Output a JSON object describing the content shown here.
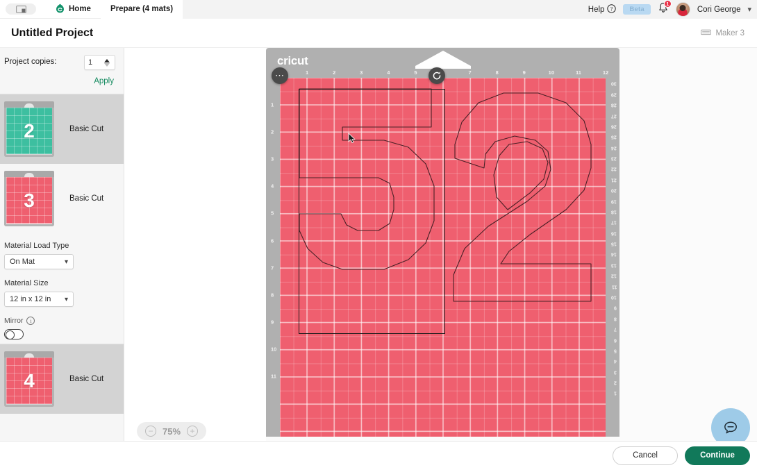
{
  "topnav": {
    "panel_toggle_icon": "panel-layout-icon",
    "home_label": "Home",
    "home_icon": "cricut-home-icon",
    "prepare_label": "Prepare (4 mats)",
    "help_label": "Help",
    "help_icon": "question-circle-icon",
    "beta_label": "Beta",
    "bell_icon": "notification-bell-icon",
    "bell_count": "1",
    "avatar_icon": "user-avatar",
    "user_name": "Cori George",
    "caret_icon": "chevron-down-icon"
  },
  "title_row": {
    "project_title": "Untitled Project",
    "machine_icon": "cutting-machine-icon",
    "machine_name": "Maker 3"
  },
  "sidebar": {
    "copies_label": "Project copies:",
    "copies_value": "1",
    "stepper_up_icon": "caret-up-icon",
    "stepper_down_icon": "caret-down-icon",
    "apply_label": "Apply",
    "mats": [
      {
        "number": "2",
        "label": "Basic Cut",
        "color": "#3dbfa0",
        "selected": false
      },
      {
        "number": "3",
        "label": "Basic Cut",
        "color": "#ef5f6f",
        "selected": true
      },
      {
        "number": "4",
        "label": "Basic Cut",
        "color": "#ef5f6f",
        "selected": false
      }
    ],
    "material_load_type_label": "Material Load Type",
    "material_load_type_value": "On Mat",
    "material_size_label": "Material Size",
    "material_size_value": "12 in x 12 in",
    "mirror_label": "Mirror",
    "mirror_info_icon": "info-circle-icon",
    "mirror_on": false,
    "chevron_icon": "chevron-down-icon"
  },
  "stage": {
    "mat_brand": "cricut",
    "mat_color": "#ef5f6f",
    "more_options_icon": "more-dots-icon",
    "rotate_icon": "rotate-clockwise-icon",
    "cursor_icon": "mouse-pointer-icon",
    "ruler_top": [
      "1",
      "2",
      "3",
      "4",
      "5",
      "6",
      "7",
      "8",
      "9",
      "10",
      "11",
      "12"
    ],
    "ruler_left": [
      "1",
      "2",
      "3",
      "4",
      "5",
      "6",
      "7",
      "8",
      "9",
      "10",
      "11"
    ],
    "ruler_right": [
      "30",
      "29",
      "28",
      "27",
      "26",
      "25",
      "24",
      "23",
      "22",
      "21",
      "20",
      "19",
      "18",
      "17",
      "16",
      "15",
      "14",
      "13",
      "12",
      "11",
      "10",
      "9",
      "8",
      "7",
      "6",
      "5",
      "4",
      "3",
      "2",
      "1"
    ],
    "design_text": "52",
    "zoom": {
      "minus_icon": "minus-circle-icon",
      "value": "75%",
      "plus_icon": "plus-circle-icon"
    },
    "chat_icon": "chat-bubble-icon"
  },
  "bottom_bar": {
    "cancel_label": "Cancel",
    "continue_label": "Continue"
  },
  "colors": {
    "accent_green": "#11795a",
    "mat_pink": "#ef5f6f",
    "mat_teal": "#3dbfa0",
    "beta_blue": "#b9d9f2",
    "chat_blue": "#9ecbe8",
    "badge_red": "#e8344a"
  }
}
